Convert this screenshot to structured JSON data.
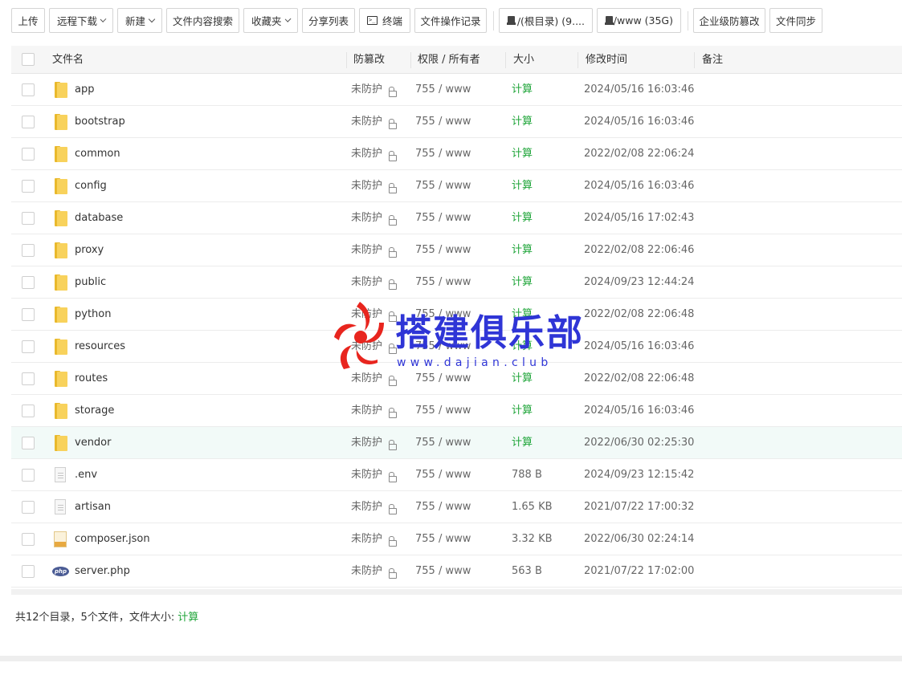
{
  "toolbar": {
    "upload": "上传",
    "remote_download": "远程下载",
    "new": "新建",
    "content_search": "文件内容搜索",
    "favorites": "收藏夹",
    "share_list": "分享列表",
    "terminal": "终端",
    "op_log": "文件操作记录",
    "disk_root": "/(根目录) (9....",
    "disk_www": "/www (35G)",
    "enterprise_tamper": "企业级防篡改",
    "file_sync": "文件同步"
  },
  "table": {
    "headers": {
      "name": "文件名",
      "tamper": "防篡改",
      "perm": "权限 / 所有者",
      "size": "大小",
      "mtime": "修改时间",
      "note": "备注"
    },
    "rows": [
      {
        "name": "app",
        "type": "folder",
        "tamper": "未防护",
        "perm": "755 / www",
        "size": "计算",
        "mtime": "2024/05/16 16:03:46"
      },
      {
        "name": "bootstrap",
        "type": "folder",
        "tamper": "未防护",
        "perm": "755 / www",
        "size": "计算",
        "mtime": "2024/05/16 16:03:46"
      },
      {
        "name": "common",
        "type": "folder",
        "tamper": "未防护",
        "perm": "755 / www",
        "size": "计算",
        "mtime": "2022/02/08 22:06:24"
      },
      {
        "name": "config",
        "type": "folder",
        "tamper": "未防护",
        "perm": "755 / www",
        "size": "计算",
        "mtime": "2024/05/16 16:03:46"
      },
      {
        "name": "database",
        "type": "folder",
        "tamper": "未防护",
        "perm": "755 / www",
        "size": "计算",
        "mtime": "2024/05/16 17:02:43"
      },
      {
        "name": "proxy",
        "type": "folder",
        "tamper": "未防护",
        "perm": "755 / www",
        "size": "计算",
        "mtime": "2022/02/08 22:06:46"
      },
      {
        "name": "public",
        "type": "folder",
        "tamper": "未防护",
        "perm": "755 / www",
        "size": "计算",
        "mtime": "2024/09/23 12:44:24"
      },
      {
        "name": "python",
        "type": "folder",
        "tamper": "未防护",
        "perm": "755 / www",
        "size": "计算",
        "mtime": "2022/02/08 22:06:48"
      },
      {
        "name": "resources",
        "type": "folder",
        "tamper": "未防护",
        "perm": "755 / www",
        "size": "计算",
        "mtime": "2024/05/16 16:03:46"
      },
      {
        "name": "routes",
        "type": "folder",
        "tamper": "未防护",
        "perm": "755 / www",
        "size": "计算",
        "mtime": "2022/02/08 22:06:48"
      },
      {
        "name": "storage",
        "type": "folder",
        "tamper": "未防护",
        "perm": "755 / www",
        "size": "计算",
        "mtime": "2024/05/16 16:03:46"
      },
      {
        "name": "vendor",
        "type": "folder",
        "tamper": "未防护",
        "perm": "755 / www",
        "size": "计算",
        "mtime": "2022/06/30 02:25:30",
        "highlighted": true
      },
      {
        "name": ".env",
        "type": "file",
        "tamper": "未防护",
        "perm": "755 / www",
        "size": "788 B",
        "mtime": "2024/09/23 12:15:42"
      },
      {
        "name": "artisan",
        "type": "file",
        "tamper": "未防护",
        "perm": "755 / www",
        "size": "1.65 KB",
        "mtime": "2021/07/22 17:00:32"
      },
      {
        "name": "composer.json",
        "type": "json",
        "tamper": "未防护",
        "perm": "755 / www",
        "size": "3.32 KB",
        "mtime": "2022/06/30 02:24:14"
      },
      {
        "name": "server.php",
        "type": "php",
        "tamper": "未防护",
        "perm": "755 / www",
        "size": "563 B",
        "mtime": "2021/07/22 17:02:00"
      }
    ]
  },
  "footer": {
    "summary": "共12个目录，5个文件，文件大小:",
    "calc": "计算"
  },
  "watermark": {
    "title": "搭建俱乐部",
    "url": "www.dajian.club"
  },
  "icons": {
    "php_label": "php"
  },
  "colors": {
    "accent_green": "#20a53a",
    "folder_yellow": "#f8d25c",
    "watermark_blue": "#2f35d6",
    "watermark_red": "#e8251e"
  }
}
